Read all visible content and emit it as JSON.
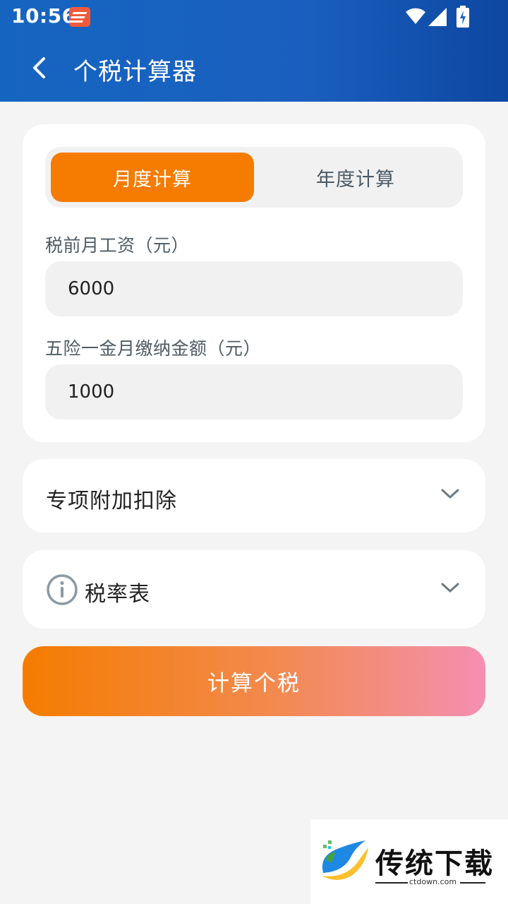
{
  "status_bar": {
    "time": "10:56"
  },
  "app_bar": {
    "title": "个税计算器"
  },
  "mode_toggle": {
    "monthly_label": "月度计算",
    "yearly_label": "年度计算",
    "selected": "monthly"
  },
  "form": {
    "salary_label": "税前月工资（元）",
    "salary_value": "6000",
    "insurance_label": "五险一金月缴纳金额（元）",
    "insurance_value": "1000"
  },
  "deduction_section": {
    "title": "专项附加扣除"
  },
  "taxrate_section": {
    "title": "税率表"
  },
  "calculate_button": {
    "label": "计算个税"
  },
  "watermark": {
    "brand": "传统下载",
    "domain": "ctdown.com"
  },
  "colors": {
    "app_bar": "#1565c0",
    "accent": "#f57c00",
    "button_end": "#f48fb1"
  },
  "icons": [
    "back-arrow-icon",
    "wifi-icon",
    "signal-icon",
    "battery-icon",
    "info-icon",
    "chevron-down-icon"
  ]
}
